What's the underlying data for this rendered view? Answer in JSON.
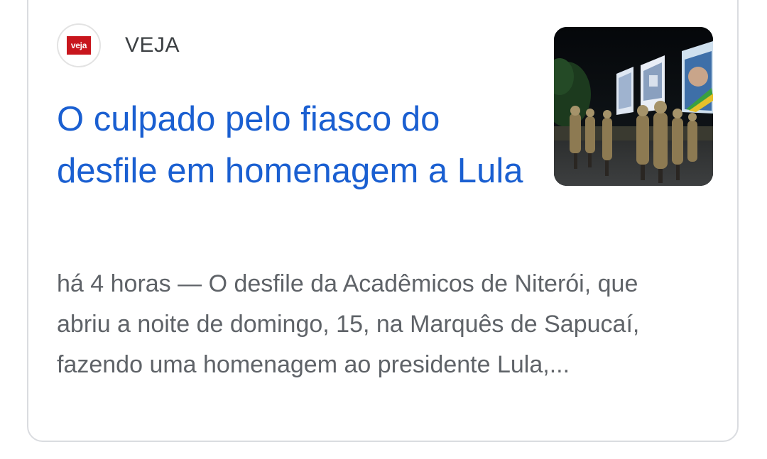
{
  "result_card": {
    "source": {
      "favicon_text": "veja",
      "name": "VEJA"
    },
    "headline": "O culpado pelo fiasco do desfile em homenagem a Lula",
    "snippet": {
      "time": "há 4 horas",
      "separator": "—",
      "text": "O desfile da Acadêmicos de Niterói, que abriu a noite de domingo, 15, na Marquês de Sapucaí, fazendo uma homenagem ao presidente Lula,..."
    },
    "thumbnail": {
      "icon": "news-photo-thumbnail"
    },
    "colors": {
      "headline": "#1a5fd1",
      "snippet": "#5f6368",
      "favicon_bg": "#c8161d",
      "border": "#dadce0"
    }
  }
}
